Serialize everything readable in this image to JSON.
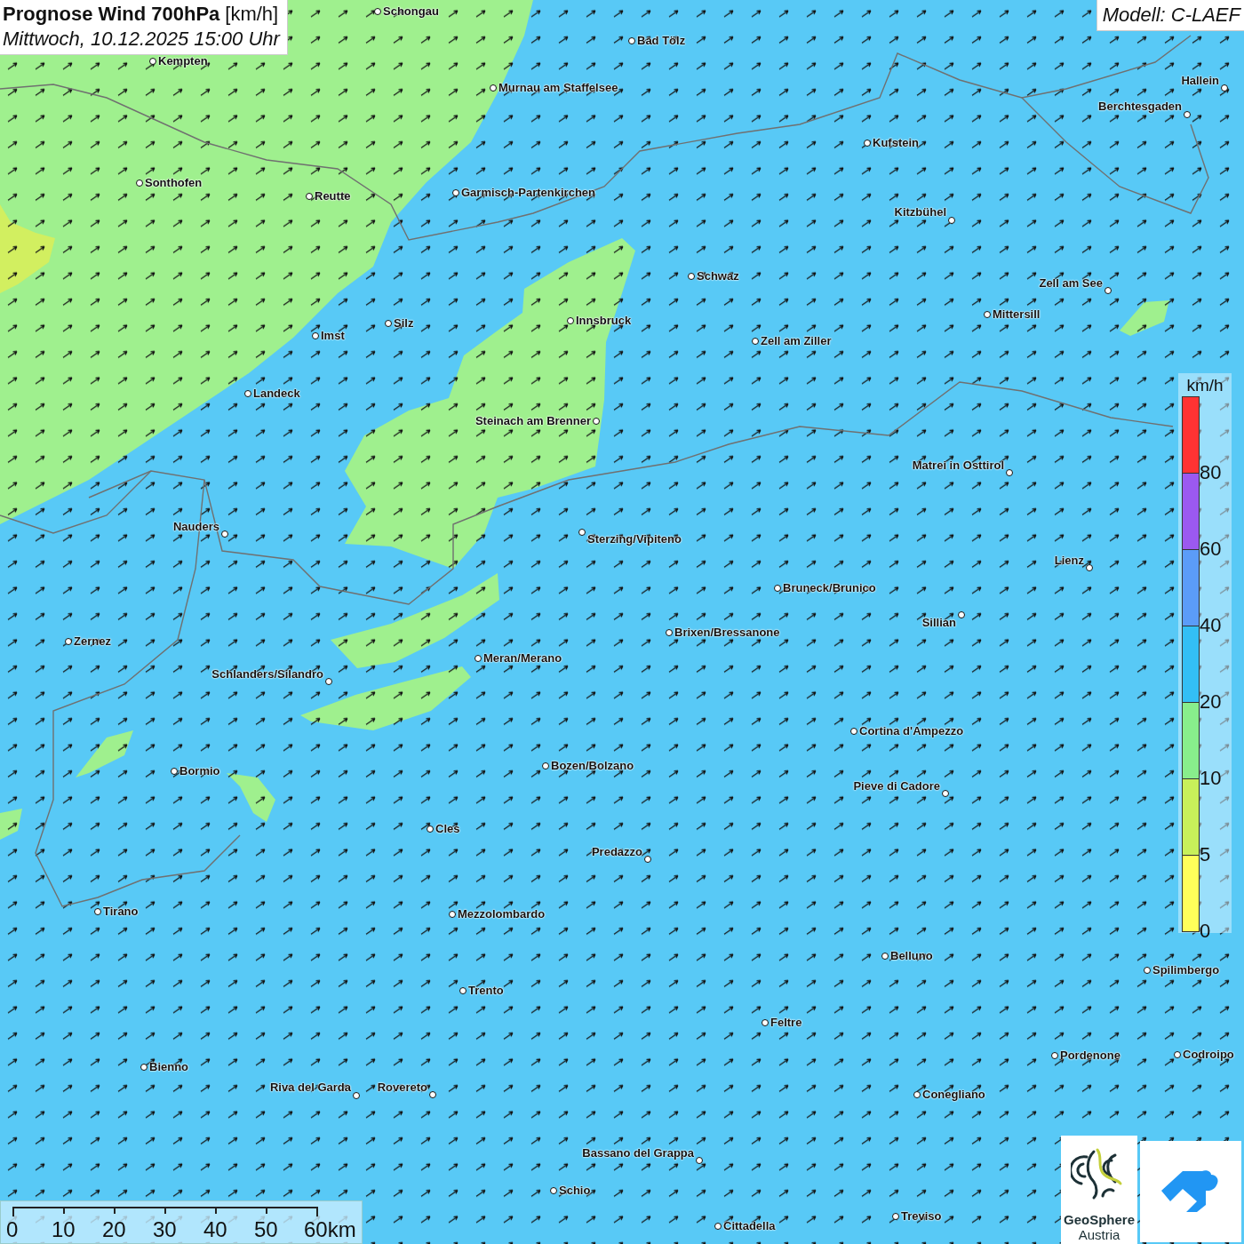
{
  "title": {
    "text": "Prognose Wind 700hPa",
    "unit": "[km/h]",
    "datetime": "Mittwoch, 10.12.2025 15:00 Uhr"
  },
  "model": "Modell: C-LAEF",
  "cities": [
    {
      "name": "Schongau"
    },
    {
      "name": "Bad Tölz"
    },
    {
      "name": "Kempten"
    },
    {
      "name": "Murnau am Staffelsee"
    },
    {
      "name": "Hallein"
    },
    {
      "name": "Berchtesgaden"
    },
    {
      "name": "Kufstein"
    },
    {
      "name": "Sonthofen"
    },
    {
      "name": "Reutte"
    },
    {
      "name": "Garmisch-Partenkirchen"
    },
    {
      "name": "Kitzbühel"
    },
    {
      "name": "Schwaz"
    },
    {
      "name": "Zell am See"
    },
    {
      "name": "Mittersill"
    },
    {
      "name": "Innsbruck"
    },
    {
      "name": "Silz"
    },
    {
      "name": "Imst"
    },
    {
      "name": "Zell am Ziller"
    },
    {
      "name": "Landeck"
    },
    {
      "name": "Steinach am Brenner"
    },
    {
      "name": "Matrei in Osttirol"
    },
    {
      "name": "Nauders"
    },
    {
      "name": "Sterzing/Vipiteno"
    },
    {
      "name": "Lienz"
    },
    {
      "name": "Bruneck/Brunico"
    },
    {
      "name": "Sillian"
    },
    {
      "name": "Brixen/Bressanone"
    },
    {
      "name": "Zernez"
    },
    {
      "name": "Meran/Merano"
    },
    {
      "name": "Schlanders/Silandro"
    },
    {
      "name": "Cortina d'Ampezzo"
    },
    {
      "name": "Bozen/Bolzano"
    },
    {
      "name": "Bormio"
    },
    {
      "name": "Pieve di Cadore"
    },
    {
      "name": "Cles"
    },
    {
      "name": "Predazzo"
    },
    {
      "name": "Tirano"
    },
    {
      "name": "Mezzolombardo"
    },
    {
      "name": "Belluno"
    },
    {
      "name": "Spilimbergo"
    },
    {
      "name": "Trento"
    },
    {
      "name": "Feltre"
    },
    {
      "name": "Pordenone"
    },
    {
      "name": "Codroipo"
    },
    {
      "name": "Bienno"
    },
    {
      "name": "Riva del Garda"
    },
    {
      "name": "Rovereto"
    },
    {
      "name": "Conegliano"
    },
    {
      "name": "Bassano del Grappa"
    },
    {
      "name": "Schio"
    },
    {
      "name": "Treviso"
    },
    {
      "name": "Cittadella"
    }
  ],
  "legend": {
    "unit": "km/h",
    "classes": [
      {
        "color": "#ff3333",
        "label": "80"
      },
      {
        "color": "#9b59f0",
        "label": "60"
      },
      {
        "color": "#5b9cf8",
        "label": "40"
      },
      {
        "color": "#33bff5",
        "label": "20"
      },
      {
        "color": "#88ee8c",
        "label": "10"
      },
      {
        "color": "#c8f05a",
        "label": "5"
      },
      {
        "color": "#ffff5a",
        "label": "0"
      }
    ]
  },
  "scale_bar": {
    "labels": [
      "0",
      "10",
      "20",
      "30",
      "40",
      "50",
      "60km"
    ]
  },
  "logos": [
    {
      "kind": "geosphere",
      "name": "GeoSphere",
      "sub": "Austria"
    },
    {
      "kind": "app"
    }
  ]
}
